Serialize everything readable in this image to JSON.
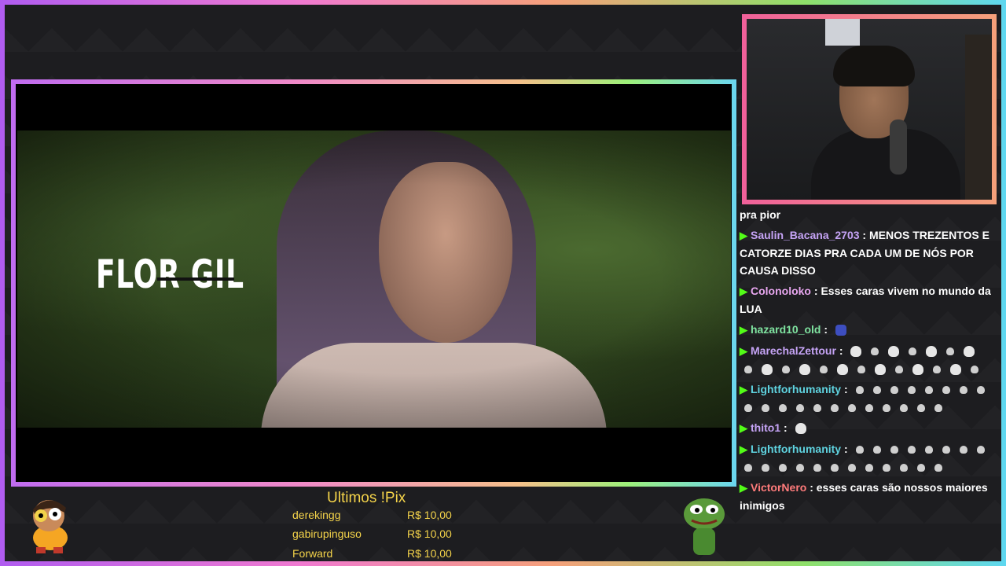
{
  "video": {
    "overlay_title": "FLOR GIL"
  },
  "chat": {
    "messages": [
      {
        "user": "",
        "text": "pra pior"
      },
      {
        "user": "Saulin_Bacana_2703",
        "text": ": MENOS TREZENTOS E CATORZE DIAS PRA CADA UM DE NÓS POR CAUSA DISSO"
      },
      {
        "user": "Colonoloko",
        "text": ": Esses caras vivem no mundo da LUA"
      },
      {
        "user": "hazard10_old",
        "text": ":"
      },
      {
        "user": "MarechalZettour",
        "text": ":"
      },
      {
        "user": "Lightforhumanity",
        "text": ":"
      },
      {
        "user": "thito1",
        "text": ":"
      },
      {
        "user": "Lightforhumanity",
        "text": ":"
      },
      {
        "user": "VictorNero",
        "text": ": esses caras são nossos maiores inimigos"
      }
    ],
    "badge_icon": "kick-badge-icon",
    "badge_color": "#53fc18"
  },
  "pix": {
    "title": "Ultimos !Pix",
    "entries": [
      {
        "name": "derekingg",
        "amount": "R$ 10,00"
      },
      {
        "name": "gabirupinguso",
        "amount": "R$ 10,00"
      },
      {
        "name": "Forward",
        "amount": "R$ 10,00"
      }
    ],
    "color": "#f5d44a"
  },
  "icons": {
    "mascot": "cartoon-mascot-icon",
    "pepe": "pepe-frog-icon"
  }
}
